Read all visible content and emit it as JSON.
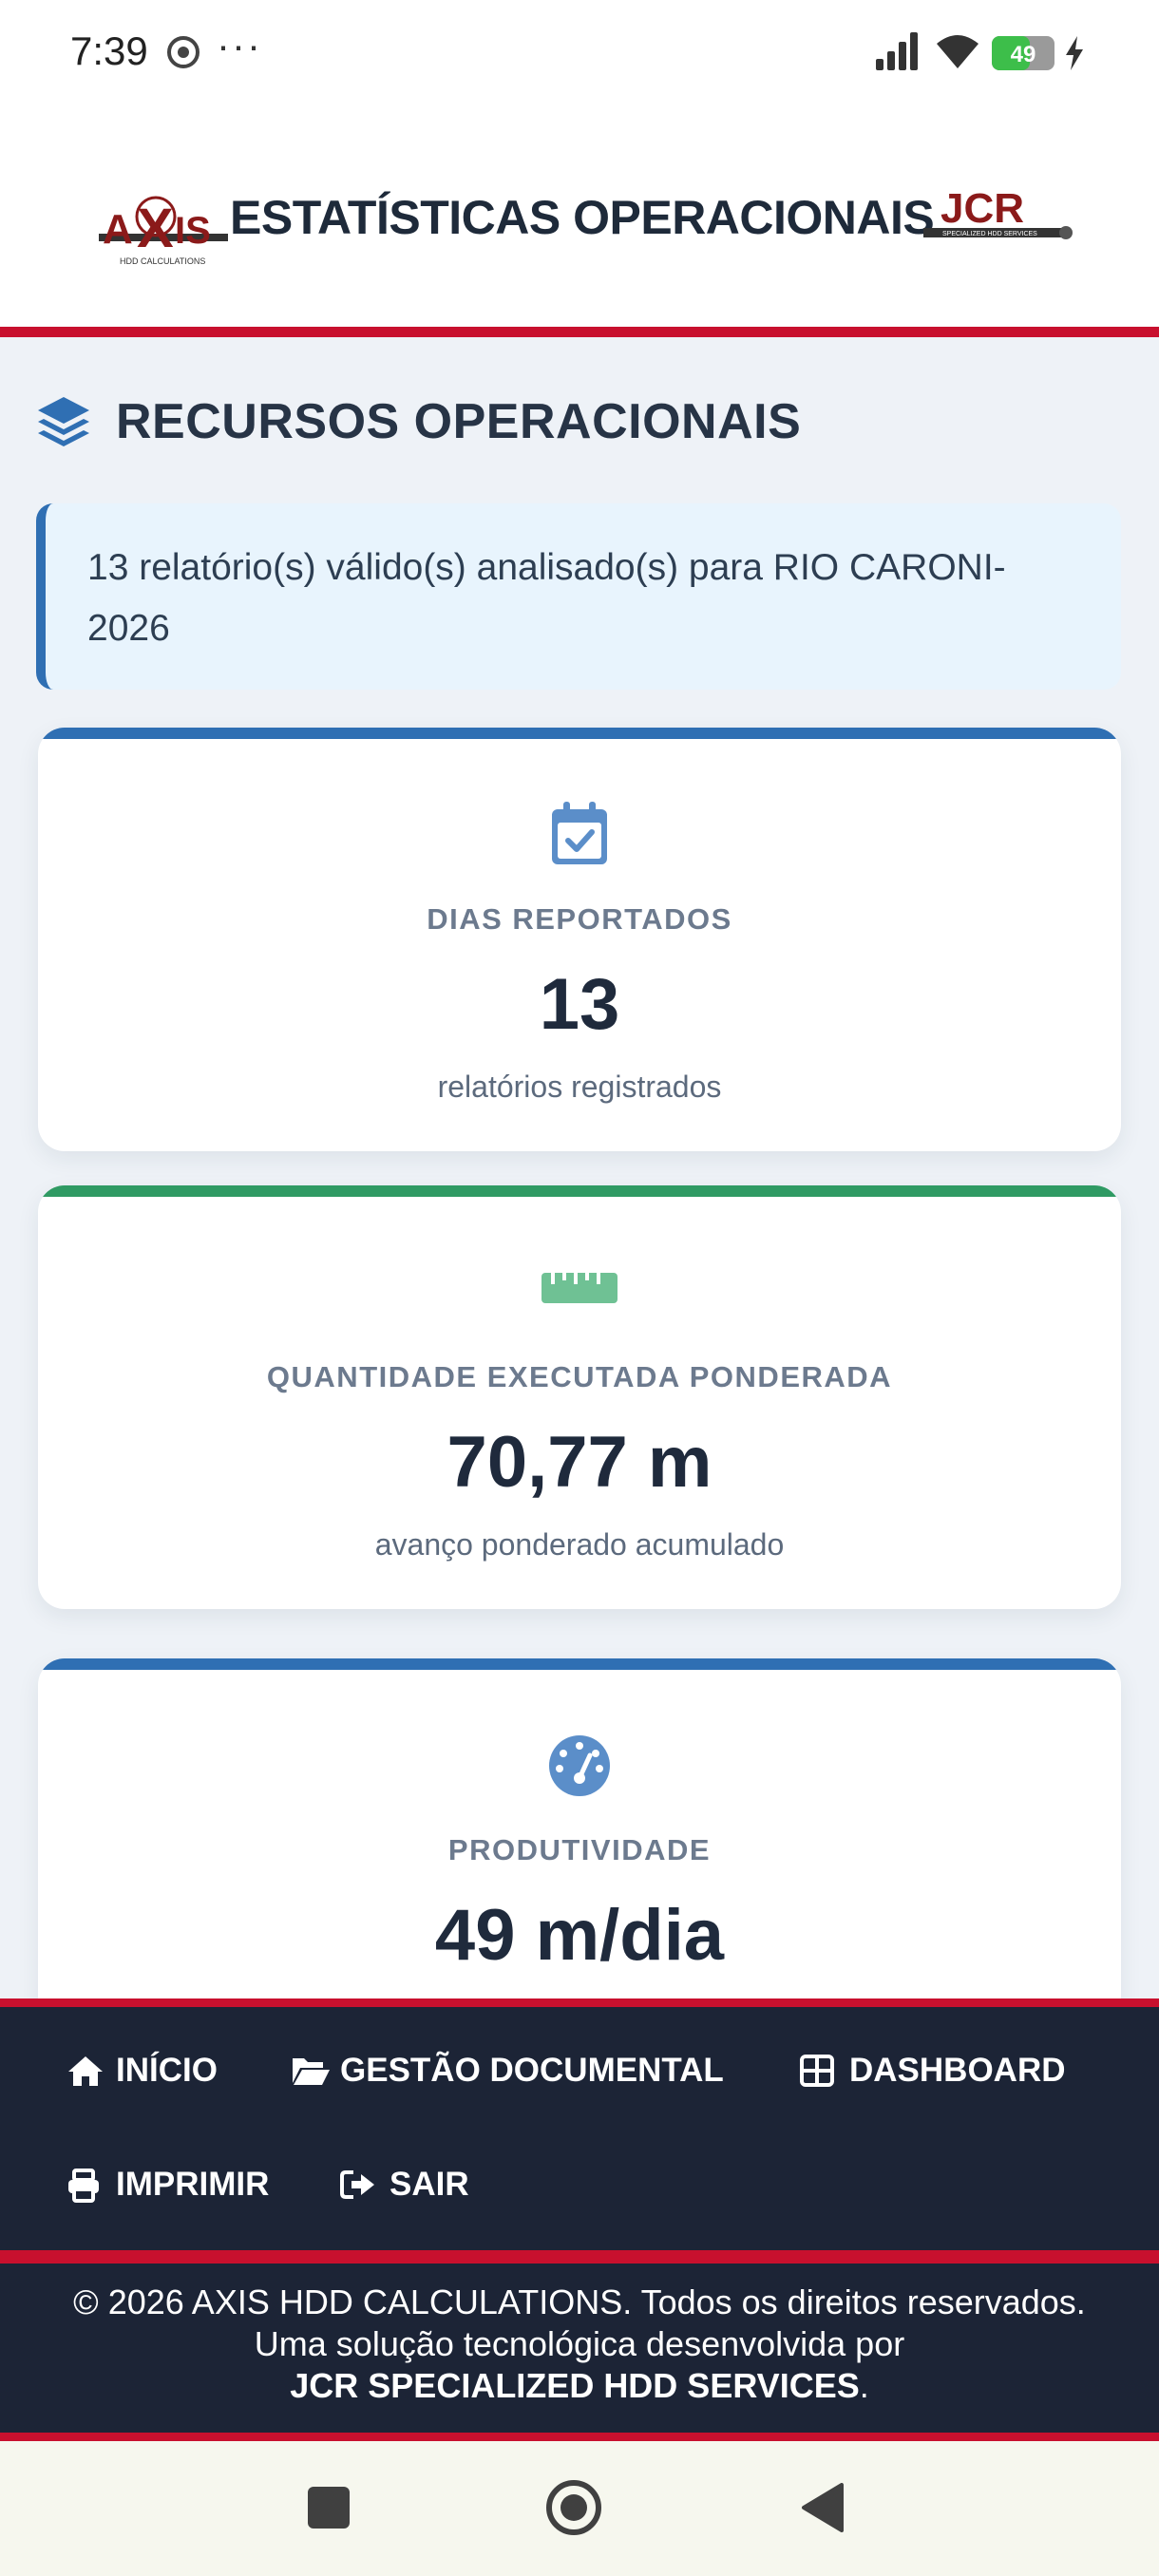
{
  "status_bar": {
    "time": "7:39",
    "dots": "···",
    "battery_level": "49",
    "battery_color": "#3dbe4a"
  },
  "header": {
    "title": "ESTATÍSTICAS OPERACIONAIS",
    "logo_left": "AXIS HDD CALCULATIONS",
    "logo_right": "JCR SPECIALIZED HDD SERVICES",
    "accent_color": "#c8102e"
  },
  "section": {
    "icon": "layers-icon",
    "title": "RECURSOS OPERACIONAIS"
  },
  "info": {
    "text_line1": "13 relatório(s) válido(s) analisado(s) para RIO CARONI-",
    "text_line2": "2026"
  },
  "cards": [
    {
      "icon": "calendar-check-icon",
      "label": "DIAS REPORTADOS",
      "value": "13",
      "sub": "relatórios registrados",
      "accent": "#2f6fb3"
    },
    {
      "icon": "ruler-icon",
      "label": "QUANTIDADE EXECUTADA PONDERADA",
      "value": "70,77 m",
      "sub": "avanço ponderado acumulado",
      "accent": "#2f9a63"
    },
    {
      "icon": "gauge-icon",
      "label": "PRODUTIVIDADE",
      "value": "49 m/dia",
      "accent": "#2f6fb3"
    }
  ],
  "nav": {
    "inicio": "INÍCIO",
    "gestao": "GESTÃO DOCUMENTAL",
    "dashboard": "DASHBOARD",
    "imprimir": "IMPRIMIR",
    "sair": "SAIR"
  },
  "footer": {
    "line1": "© 2026 AXIS HDD CALCULATIONS. Todos os direitos reservados.",
    "line2": "Uma solução tecnológica desenvolvida por",
    "line3_bold": "JCR SPECIALIZED HDD SERVICES",
    "line3_end": "."
  }
}
